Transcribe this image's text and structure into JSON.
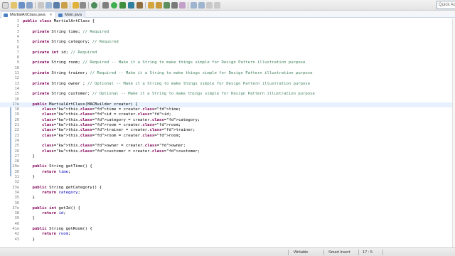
{
  "toolbar": {
    "quick_access_placeholder": "Quick Acce"
  },
  "tabs": [
    {
      "label": "MartialArtClass.java"
    },
    {
      "label": "Main.java"
    }
  ],
  "editor": {
    "lines": [
      {
        "n": "1",
        "t": "public class MartialArtClass {"
      },
      {
        "n": "2",
        "t": ""
      },
      {
        "n": "3",
        "t": "    private String time; // Required"
      },
      {
        "n": "4",
        "t": ""
      },
      {
        "n": "5",
        "t": "    private String category; // Required"
      },
      {
        "n": "6",
        "t": ""
      },
      {
        "n": "7",
        "t": "    private int id; // Required"
      },
      {
        "n": "8",
        "t": ""
      },
      {
        "n": "9",
        "t": "    private String room; // Required -- Make it a String to make things simple for Design Pattern illustration purpose"
      },
      {
        "n": "10",
        "t": ""
      },
      {
        "n": "11",
        "t": "    private String trainer; // Required -- Make it a String to make things simple for Design Pattern illustration purpose"
      },
      {
        "n": "12",
        "t": ""
      },
      {
        "n": "13",
        "t": "    private String owner ; // Optional -- Make it a String to make things simple for Design Pattern illustration purpose"
      },
      {
        "n": "14",
        "t": ""
      },
      {
        "n": "15",
        "t": "    private String customer; // Optional -- Make it a String to make things simple for Design Pattern illustration purpose"
      },
      {
        "n": "16",
        "t": ""
      },
      {
        "n": "17⊖",
        "t": "    public MartialArtClass(MACBuilder creater) {"
      },
      {
        "n": "18",
        "t": "        this.time = creater.time;"
      },
      {
        "n": "19",
        "t": "        this.id = creater.id;"
      },
      {
        "n": "20",
        "t": "        this.category = creater.category;"
      },
      {
        "n": "21",
        "t": "        this.room = creater.room;"
      },
      {
        "n": "22",
        "t": "        this.trainer = creater.trainer;"
      },
      {
        "n": "23",
        "t": "        this.room = creater.room;"
      },
      {
        "n": "24",
        "t": ""
      },
      {
        "n": "25",
        "t": "        this.owner = creater.owner;"
      },
      {
        "n": "26",
        "t": "        this.customer = creater.customer;"
      },
      {
        "n": "27",
        "t": "    }"
      },
      {
        "n": "28",
        "t": ""
      },
      {
        "n": "29⊖",
        "t": "    public String getTime() {"
      },
      {
        "n": "30",
        "t": "        return time;"
      },
      {
        "n": "31",
        "t": "    }"
      },
      {
        "n": "32",
        "t": ""
      },
      {
        "n": "33⊖",
        "t": "    public String getCategory() {"
      },
      {
        "n": "34",
        "t": "        return category;"
      },
      {
        "n": "35",
        "t": "    }"
      },
      {
        "n": "36",
        "t": ""
      },
      {
        "n": "37⊖",
        "t": "    public int getId() {"
      },
      {
        "n": "38",
        "t": "        return id;"
      },
      {
        "n": "39",
        "t": "    }"
      },
      {
        "n": "40",
        "t": ""
      },
      {
        "n": "41⊖",
        "t": "    public String getRoom() {"
      },
      {
        "n": "42",
        "t": "        return room;"
      },
      {
        "n": "43",
        "t": "    }"
      }
    ],
    "highlighted_line": "17⊖"
  },
  "status": {
    "writable": "Writable",
    "insert_mode": "Smart Insert",
    "position": "17 : 5"
  },
  "colors": {
    "keyword": "#7f0055",
    "comment": "#3f7f5f",
    "field": "#0000c0",
    "current_line": "#e8f2fe"
  }
}
